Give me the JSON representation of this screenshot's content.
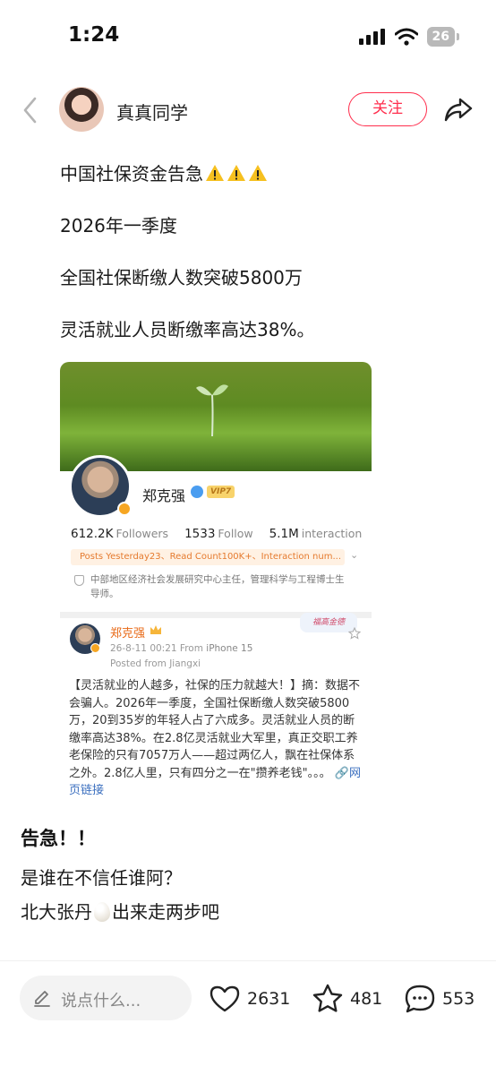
{
  "status_bar": {
    "time": "1:24",
    "battery": "26"
  },
  "header": {
    "author_name": "真真同学",
    "follow_label": "关注"
  },
  "post": {
    "line1": "中国社保资金告急",
    "line2": "2026年一季度",
    "line3": "全国社保断缴人数突破5800万",
    "line4": "灵活就业人员断缴率高达38%。"
  },
  "embedded": {
    "profile_name": "郑克强",
    "vip_label": "VIP7",
    "followers_value": "612.2K",
    "followers_label": "Followers",
    "follow_value": "1533",
    "follow_label": "Follow",
    "interaction_value": "5.1M",
    "interaction_label": "interaction",
    "stats_pill": "Posts Yesterday23、Read Count100K+、Interaction num...",
    "bio": "中部地区经济社会发展研究中心主任，管理科学与工程博士生导师。",
    "post_author": "郑克强",
    "post_time": "26-8-11 00:21",
    "post_device_prefix": "From",
    "post_device": "iPhone 15",
    "posted_from": "Posted from Jiangxi",
    "sticker": "福高金德",
    "post_text": "【灵活就业的人越多，社保的压力就越大！】摘：数据不会骗人。2026年一季度，全国社保断缴人数突破5800万，20到35岁的年轻人占了六成多。灵活就业人员的断缴率高达38%。在2.8亿灵活就业大军里，真正交职工养老保险的只有7057万人——超过两亿人，飘在社保体系之外。2.8亿人里，只有四分之一在\"攒养老钱\"。。。",
    "post_link": "网页链接"
  },
  "tail": {
    "title": "告急！！",
    "line1": "是谁在不信任谁阿？",
    "line2_before": "北大张丹",
    "line2_after": "出来走两步吧"
  },
  "bottom_bar": {
    "comment_placeholder": "说点什么...",
    "likes": "2631",
    "favorites": "481",
    "comments": "553"
  },
  "colors": {
    "accent": "#ff2e4d",
    "weibo_orange": "#e86a17",
    "link": "#3b6fbf"
  }
}
